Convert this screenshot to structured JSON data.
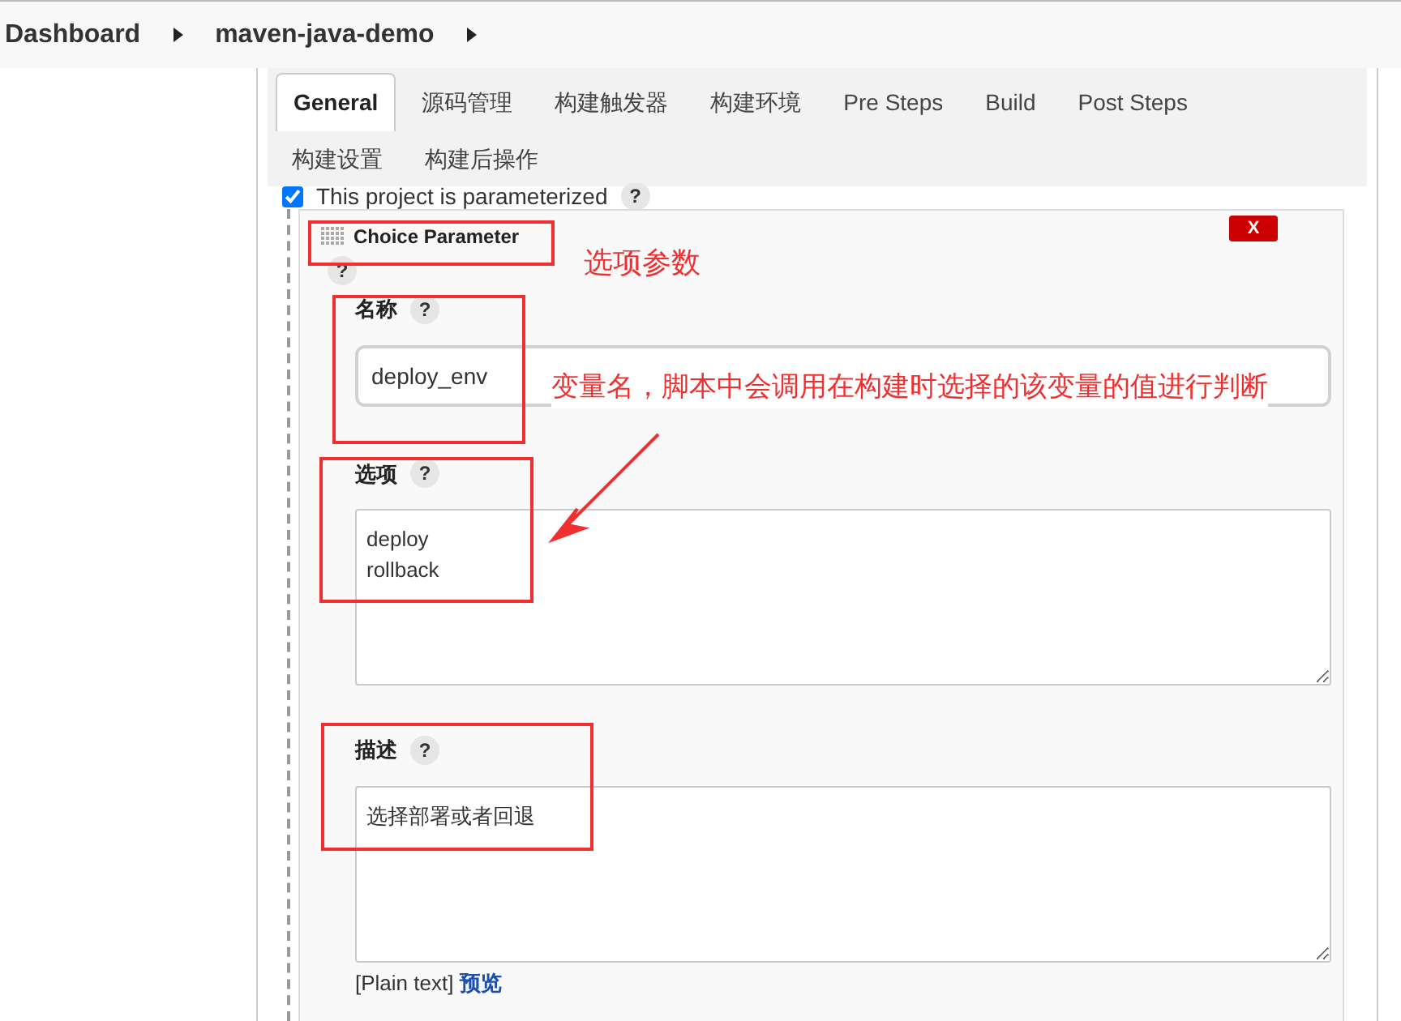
{
  "breadcrumbs": [
    {
      "label": "Dashboard"
    },
    {
      "label": "maven-java-demo"
    }
  ],
  "tabs": [
    {
      "label": "General",
      "selected": true
    },
    {
      "label": "源码管理",
      "selected": false
    },
    {
      "label": "构建触发器",
      "selected": false
    },
    {
      "label": "构建环境",
      "selected": false
    },
    {
      "label": "Pre Steps",
      "selected": false
    },
    {
      "label": "Build",
      "selected": false
    },
    {
      "label": "Post Steps",
      "selected": false
    },
    {
      "label": "构建设置",
      "selected": false
    },
    {
      "label": "构建后操作",
      "selected": false
    }
  ],
  "parameterized": {
    "label": "This project is parameterized",
    "checked": true,
    "help": "?"
  },
  "parameter": {
    "title": "Choice Parameter",
    "help": "?",
    "delete": "X",
    "name": {
      "label": "名称",
      "help": "?",
      "value": "deploy_env"
    },
    "choices": {
      "label": "选项",
      "help": "?",
      "lines": [
        "deploy",
        "rollback"
      ]
    },
    "description": {
      "label": "描述",
      "help": "?",
      "value": "选择部署或者回退"
    },
    "format": {
      "note": "[Plain text]",
      "link": "预览"
    }
  },
  "annotations": [
    {
      "text": "选项参数"
    },
    {
      "text": "变量名，脚本中会调用在构建时选择的该变量的值进行判断"
    }
  ]
}
